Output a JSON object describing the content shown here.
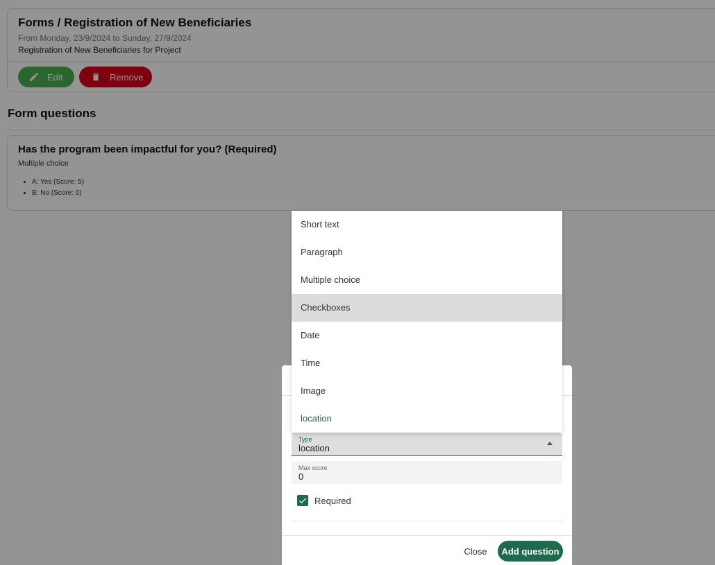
{
  "colors": {
    "primary": "#1e6a4f",
    "edit": "#4caf50",
    "danger": "#d9001b",
    "overlay": "rgba(0,0,0,0.42)"
  },
  "form": {
    "title": "Forms / Registration of New Beneficiaries",
    "dates": "From Monday, 23/9/2024 to Sunday, 27/9/2024",
    "description": "Registration of New Beneficiaries for Project",
    "edit_label": "Edit",
    "edit_icon": "pencil-icon",
    "remove_label": "Remove",
    "remove_icon": "trash-icon"
  },
  "questions_section": {
    "title": "Form questions",
    "questions": [
      {
        "title": "Has the program been impactful for you? (Required)",
        "type": "Multiple choice",
        "options": [
          "A: Yes (Score: 5)",
          "B: No (Score: 0)"
        ]
      }
    ]
  },
  "dropdown": {
    "options": [
      "Short text",
      "Paragraph",
      "Multiple choice",
      "Checkboxes",
      "Date",
      "Time",
      "Image",
      "location"
    ],
    "highlighted": "Checkboxes",
    "selected": "location"
  },
  "dialog": {
    "type_label": "Type",
    "type_value": "location",
    "max_score_label": "Max score",
    "max_score_value": "0",
    "required_label": "Required",
    "required_checked": true,
    "close_label": "Close",
    "add_label": "Add question"
  }
}
